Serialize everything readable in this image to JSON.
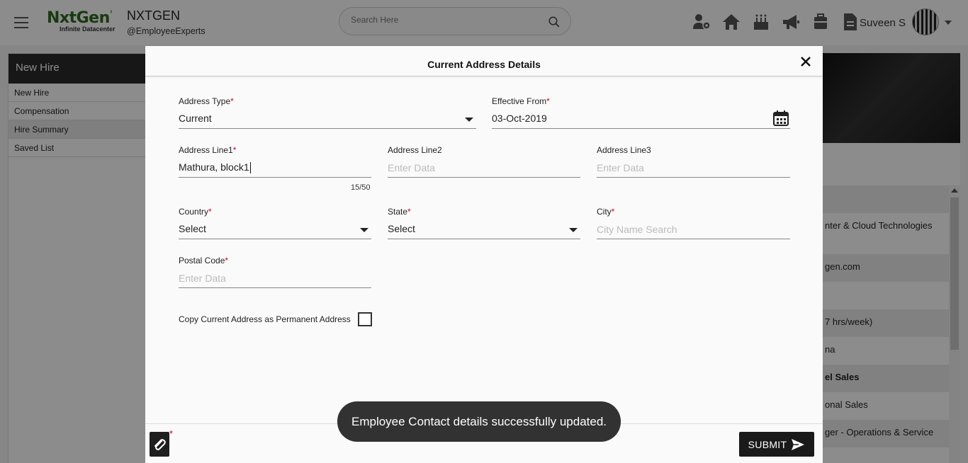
{
  "header": {
    "logo_text": "NxtGen",
    "logo_tagline": "Infinite Datacenter",
    "org_name": "NXTGEN",
    "org_handle": "@EmployeeExperts",
    "search_placeholder": "Search Here",
    "user_name": "Suveen S",
    "icons": [
      "people-settings-icon",
      "home-icon",
      "cake-icon",
      "megaphone-icon",
      "suitcase-icon",
      "document-icon"
    ]
  },
  "left_panel": {
    "title": "New Hire",
    "items": [
      {
        "label": "New Hire"
      },
      {
        "label": "Compensation"
      },
      {
        "label": "Hire Summary"
      },
      {
        "label": "Saved List"
      }
    ]
  },
  "background_rows": [
    {
      "text": ""
    },
    {
      "text": "nter & Cloud Technologies"
    },
    {
      "text": "gen.com"
    },
    {
      "text": ""
    },
    {
      "text": "7 hrs/week)"
    },
    {
      "text": "na"
    },
    {
      "text": "el Sales"
    },
    {
      "text": "onal Sales"
    },
    {
      "text": "ger - Operations & Service"
    }
  ],
  "modal": {
    "title": "Current Address Details",
    "fields": {
      "address_type": {
        "label": "Address Type",
        "value": "Current"
      },
      "effective_from": {
        "label": "Effective From",
        "value": "03-Oct-2019"
      },
      "address_line1": {
        "label": "Address Line1",
        "value": "Mathura, block1",
        "counter": "15/50"
      },
      "address_line2": {
        "label": "Address Line2",
        "placeholder": "Enter Data"
      },
      "address_line3": {
        "label": "Address Line3",
        "placeholder": "Enter Data"
      },
      "country": {
        "label": "Country",
        "value": "Select"
      },
      "state": {
        "label": "State",
        "value": "Select"
      },
      "city": {
        "label": "City",
        "placeholder": "City Name Search"
      },
      "postal_code": {
        "label": "Postal Code",
        "placeholder": "Enter Data"
      }
    },
    "required_marker": "*",
    "copy_address_label": "Copy Current Address as Permanent Address",
    "copy_address_checked": false,
    "submit_label": "SUBMIT"
  },
  "toast": {
    "message": "Employee Contact details successfully updated."
  },
  "colors": {
    "required": "#d0021b",
    "primary_dark": "#1a1a1a",
    "logo_green": "#2e6b1f",
    "toast_bg": "#323232"
  }
}
